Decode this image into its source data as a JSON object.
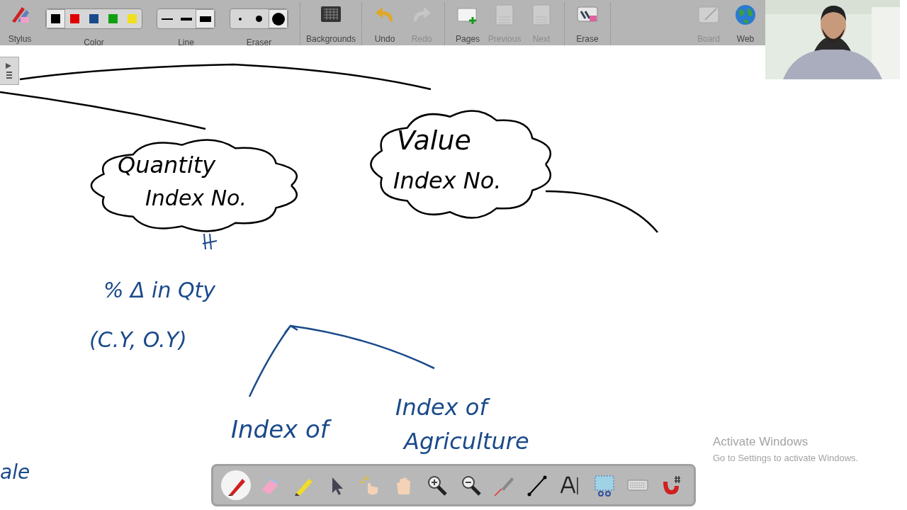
{
  "toolbar": {
    "groups": [
      {
        "kind": "tool",
        "label": "Stylus",
        "disabled": false
      },
      {
        "kind": "swatches",
        "label": "Color",
        "options": [
          {
            "color": "#000000",
            "selected": true
          },
          {
            "color": "#e00000",
            "selected": false
          },
          {
            "color": "#1a4a8a",
            "selected": false
          },
          {
            "color": "#10a010",
            "selected": false
          },
          {
            "color": "#f0e020",
            "selected": false
          }
        ]
      },
      {
        "kind": "lines",
        "label": "Line",
        "options": [
          {
            "selected": false
          },
          {
            "selected": false
          },
          {
            "selected": true
          }
        ]
      },
      {
        "kind": "dots",
        "label": "Eraser",
        "options": [
          {
            "selected": false
          },
          {
            "selected": false
          },
          {
            "selected": true
          }
        ]
      },
      {
        "kind": "tool",
        "label": "Backgrounds",
        "disabled": false
      },
      {
        "kind": "tool",
        "label": "Undo",
        "disabled": false
      },
      {
        "kind": "tool",
        "label": "Redo",
        "disabled": true
      },
      {
        "kind": "tool",
        "label": "Pages",
        "disabled": false
      },
      {
        "kind": "tool",
        "label": "Previous",
        "disabled": true
      },
      {
        "kind": "tool",
        "label": "Next",
        "disabled": true
      },
      {
        "kind": "tool",
        "label": "Erase",
        "disabled": false
      },
      {
        "kind": "spacer"
      },
      {
        "kind": "tool",
        "label": "Board",
        "disabled": true
      },
      {
        "kind": "tool",
        "label": "Web",
        "disabled": false
      }
    ]
  },
  "notes": [
    {
      "text": "Quantity",
      "color": "#000000"
    },
    {
      "text": "Index No.",
      "color": "#000000"
    },
    {
      "text": "Value",
      "color": "#000000"
    },
    {
      "text": "Index No.",
      "color": "#000000"
    },
    {
      "text": "% Δ in Qty",
      "color": "#1a4a8a"
    },
    {
      "text": "(C.Y, O.Y)",
      "color": "#1a4a8a"
    },
    {
      "text": "Index of",
      "color": "#1a4a8a"
    },
    {
      "text": "Index of",
      "color": "#1a4a8a"
    },
    {
      "text": "Agriculture",
      "color": "#1a4a8a"
    },
    {
      "text": "ale",
      "color": "#1a4a8a"
    }
  ],
  "watermark": {
    "title": "Activate Windows",
    "subtitle": "Go to Settings to activate Windows."
  },
  "floating_tools": [
    {
      "selected": true
    },
    {
      "selected": false
    },
    {
      "selected": false
    },
    {
      "selected": false
    },
    {
      "selected": false
    },
    {
      "selected": false
    },
    {
      "selected": false
    },
    {
      "selected": false
    },
    {
      "selected": false
    },
    {
      "selected": false
    },
    {
      "selected": false
    },
    {
      "selected": false
    },
    {
      "selected": false
    },
    {
      "selected": false
    }
  ]
}
